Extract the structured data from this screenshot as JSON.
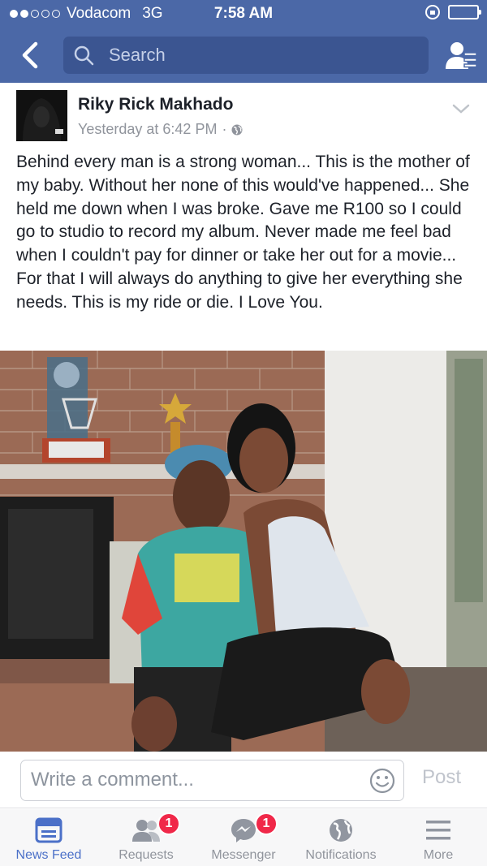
{
  "status_bar": {
    "carrier": "Vodacom",
    "network": "3G",
    "time": "7:58 AM",
    "signal_bars_filled": 2,
    "signal_bars_total": 5
  },
  "nav": {
    "search_placeholder": "Search",
    "icons": [
      "back-chevron-icon",
      "search-icon",
      "friends-list-icon"
    ]
  },
  "post": {
    "author": "Riky Rick Makhado",
    "time": "Yesterday at 6:42 PM",
    "separator": "·",
    "privacy_icon": "globe-icon",
    "text": "Behind every man is a strong woman... This is the mother of my baby. Without her none of this would've happened... She held me down when I was broke. Gave me R100 so I could go to studio to record my album. Never made me feel bad when I couldn't pay for dinner or take her out for a movie... For that I will always do anything to give her everything she needs. This is my ride or die. I Love You."
  },
  "comment": {
    "placeholder": "Write a comment...",
    "post_label": "Post"
  },
  "tabbar": {
    "tabs": [
      {
        "label": "News Feed",
        "icon": "news-feed-icon",
        "active": true
      },
      {
        "label": "Requests",
        "icon": "friend-requests-icon",
        "badge": "1"
      },
      {
        "label": "Messenger",
        "icon": "messenger-icon",
        "badge": "1"
      },
      {
        "label": "Notifications",
        "icon": "globe-icon"
      },
      {
        "label": "More",
        "icon": "menu-icon"
      }
    ]
  },
  "colors": {
    "brand": "#4b68a7",
    "search_bg": "#3b5591",
    "active_tab": "#4b70c8",
    "badge": "#f02849"
  }
}
